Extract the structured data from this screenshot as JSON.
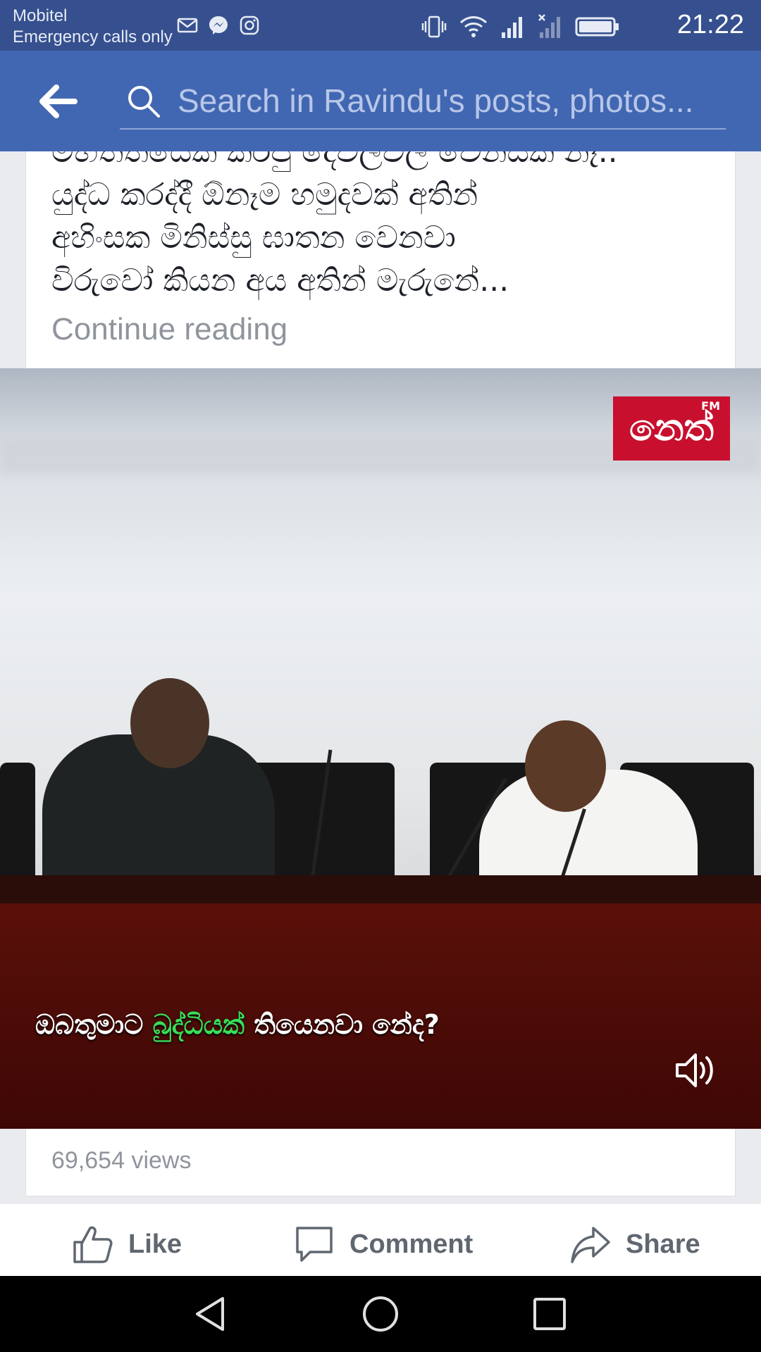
{
  "status_bar": {
    "carrier": "Mobitel",
    "network_status": "Emergency calls only",
    "time": "21:22",
    "left_icons": [
      "gmail-icon",
      "messenger-icon",
      "instagram-icon"
    ],
    "right_icons": [
      "vibrate-icon",
      "wifi-icon",
      "signal-icon",
      "no-signal-icon",
      "battery-icon"
    ]
  },
  "header": {
    "search_placeholder": "Search in Ravindu's posts, photos..."
  },
  "post": {
    "text_lines": [
      "මහත්තයෙක් කරපු දේවල්වල වෙනසක් නෑ..",
      "යුද්ධ කරද්දී ඕනෑම හමුදවක් අතින්",
      "අහිංසක මිනිස්සු ඝාතන වෙනවා",
      "විරුවෝ කියන අය අතින් මැරුනේ..."
    ],
    "continue_label": "Continue reading"
  },
  "video": {
    "logo_text": "නෙත්",
    "logo_sup": "FM",
    "caption_before": "ඔබතුමාට",
    "caption_highlight": "බුද්ධියක්",
    "caption_after": "තියෙනවා නේද?"
  },
  "stats": {
    "views": "69,654 views"
  },
  "actions": {
    "like_label": "Like",
    "comment_label": "Comment",
    "share_label": "Share"
  },
  "colors": {
    "status_bar": "#36508f",
    "header": "#4267b2",
    "caption_highlight": "#36e05a",
    "logo_red": "#c8102e"
  }
}
